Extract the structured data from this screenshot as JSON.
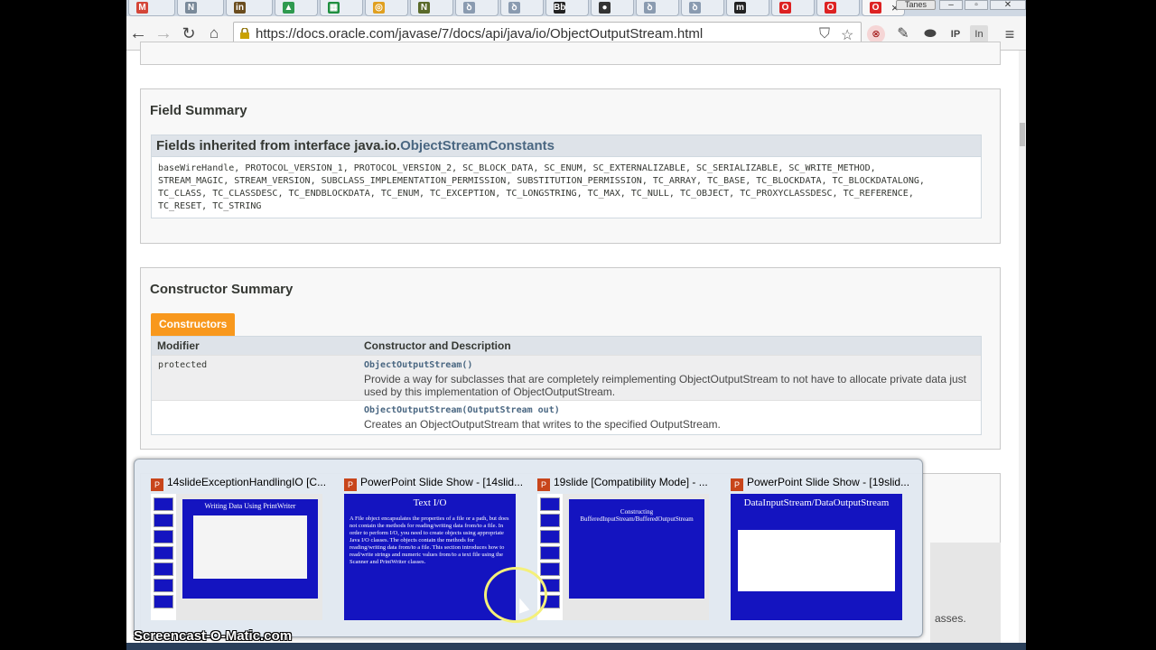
{
  "browser": {
    "url": "https://docs.oracle.com/javase/7/docs/api/java/io/ObjectOutputStream.html",
    "user_label": "Tanes",
    "tabs": [
      "M",
      "N",
      "in",
      "▲",
      "▦",
      "◎",
      "N",
      "ꝺ",
      "ꝺ",
      "Bb",
      "●",
      "ꝺ",
      "ꝺ",
      "m",
      "O",
      "O",
      "O"
    ]
  },
  "field_summary": {
    "heading": "Field Summary",
    "inherited_prefix": "Fields inherited from interface java.io.",
    "inherited_link": "ObjectStreamConstants",
    "fields_line1": "baseWireHandle, PROTOCOL_VERSION_1, PROTOCOL_VERSION_2, SC_BLOCK_DATA, SC_ENUM, SC_EXTERNALIZABLE, SC_SERIALIZABLE, SC_WRITE_METHOD,",
    "fields_line2": "STREAM_MAGIC, STREAM_VERSION, SUBCLASS_IMPLEMENTATION_PERMISSION, SUBSTITUTION_PERMISSION, TC_ARRAY, TC_BASE, TC_BLOCKDATA, TC_BLOCKDATALONG,",
    "fields_line3": "TC_CLASS, TC_CLASSDESC, TC_ENDBLOCKDATA, TC_ENUM, TC_EXCEPTION, TC_LONGSTRING, TC_MAX, TC_NULL, TC_OBJECT, TC_PROXYCLASSDESC, TC_REFERENCE,",
    "fields_line4": "TC_RESET, TC_STRING"
  },
  "constructor_summary": {
    "heading": "Constructor Summary",
    "tab_label": "Constructors",
    "col_modifier": "Modifier",
    "col_description": "Constructor and Description",
    "rows": [
      {
        "modifier": "protected",
        "signature": "ObjectOutputStream()",
        "description": "Provide a way for subclasses that are completely reimplementing ObjectOutputStream to not have to allocate private data just used by this implementation of ObjectOutputStream."
      },
      {
        "modifier": "",
        "signature": "ObjectOutputStream(OutputStream out)",
        "description": "Creates an ObjectOutputStream that writes to the specified OutputStream."
      }
    ]
  },
  "peek_text": "asses.",
  "taskbar_preview": {
    "windows": [
      {
        "title": "14slideExceptionHandlingIO [C...",
        "slide_title": "Writing Data Using PrintWriter"
      },
      {
        "title": "PowerPoint Slide Show - [14slid...",
        "slide_title": "Text I/O",
        "slide_body": "A File object encapsulates the properties of a file or a path, but does not contain the methods for reading/writing data from/to a file. In order to perform I/O, you need to create objects using appropriate Java I/O classes. The objects contain the methods for reading/writing data from/to a file. This section introduces how to read/write strings and numeric values from/to a text file using the Scanner and PrintWriter classes."
      },
      {
        "title": "19slide [Compatibility Mode] - ...",
        "slide_title": "Constructing BufferedInputStream/BufferedOutputStream"
      },
      {
        "title": "PowerPoint Slide Show - [19slid...",
        "slide_title": "DataInputStream/DataOutputStream"
      }
    ]
  },
  "watermark": "Screencast-O-Matic.com"
}
